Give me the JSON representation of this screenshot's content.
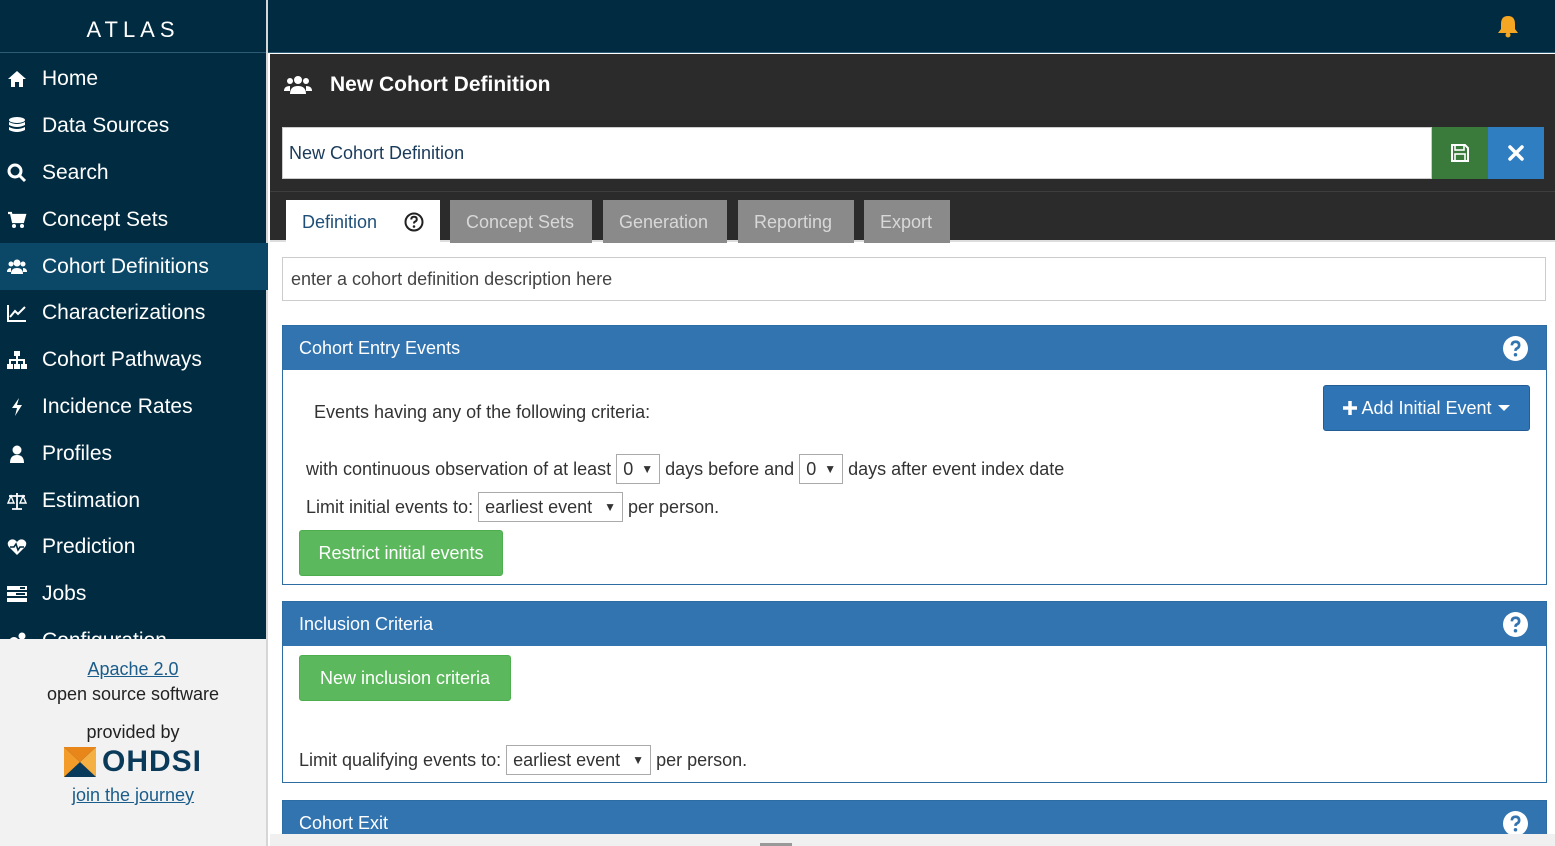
{
  "brand": "ATLAS",
  "nav": [
    {
      "label": "Home",
      "icon": "home-icon"
    },
    {
      "label": "Data Sources",
      "icon": "database-icon"
    },
    {
      "label": "Search",
      "icon": "search-icon"
    },
    {
      "label": "Concept Sets",
      "icon": "cart-icon"
    },
    {
      "label": "Cohort Definitions",
      "icon": "users-icon",
      "active": true
    },
    {
      "label": "Characterizations",
      "icon": "line-chart-icon"
    },
    {
      "label": "Cohort Pathways",
      "icon": "sitemap-icon"
    },
    {
      "label": "Incidence Rates",
      "icon": "bolt-icon"
    },
    {
      "label": "Profiles",
      "icon": "user-icon"
    },
    {
      "label": "Estimation",
      "icon": "balance-scale-icon"
    },
    {
      "label": "Prediction",
      "icon": "heartbeat-icon"
    },
    {
      "label": "Jobs",
      "icon": "tasks-icon"
    },
    {
      "label": "Configuration",
      "icon": "cogs-icon"
    }
  ],
  "footer": {
    "license": "Apache 2.0",
    "oss": "open source software",
    "provided_by": "provided by",
    "org": "OHDSI",
    "join": "join the journey"
  },
  "header": {
    "title": "New Cohort Definition"
  },
  "name_input": {
    "value": "New Cohort Definition"
  },
  "tabs": [
    {
      "label": "Definition",
      "active": true
    },
    {
      "label": "Concept Sets"
    },
    {
      "label": "Generation"
    },
    {
      "label": "Reporting"
    },
    {
      "label": "Export"
    }
  ],
  "description": {
    "placeholder": "enter a cohort definition description here"
  },
  "entry_events": {
    "title": "Cohort Entry Events",
    "criteria_text": "Events having any of the following criteria:",
    "add_button": "Add Initial Event",
    "obs_prefix": "with continuous observation of at least",
    "days_before": "0",
    "obs_middle": "days before and",
    "days_after": "0",
    "obs_suffix": "days after event index date",
    "limit_prefix": "Limit initial events to:",
    "limit_value": "earliest event",
    "limit_suffix": "per person.",
    "restrict_button": "Restrict initial events"
  },
  "inclusion": {
    "title": "Inclusion Criteria",
    "new_button": "New inclusion criteria",
    "limit_prefix": "Limit qualifying events to:",
    "limit_value": "earliest event",
    "limit_suffix": "per person."
  },
  "exit": {
    "title": "Cohort Exit"
  },
  "colors": {
    "sidebar_bg": "#002b40",
    "active_nav": "#0b4868",
    "panel_header": "#3274b0",
    "success": "#5cb85c",
    "save": "#3a7a3a",
    "close": "#2f7ec1",
    "bell": "#f5a623"
  }
}
